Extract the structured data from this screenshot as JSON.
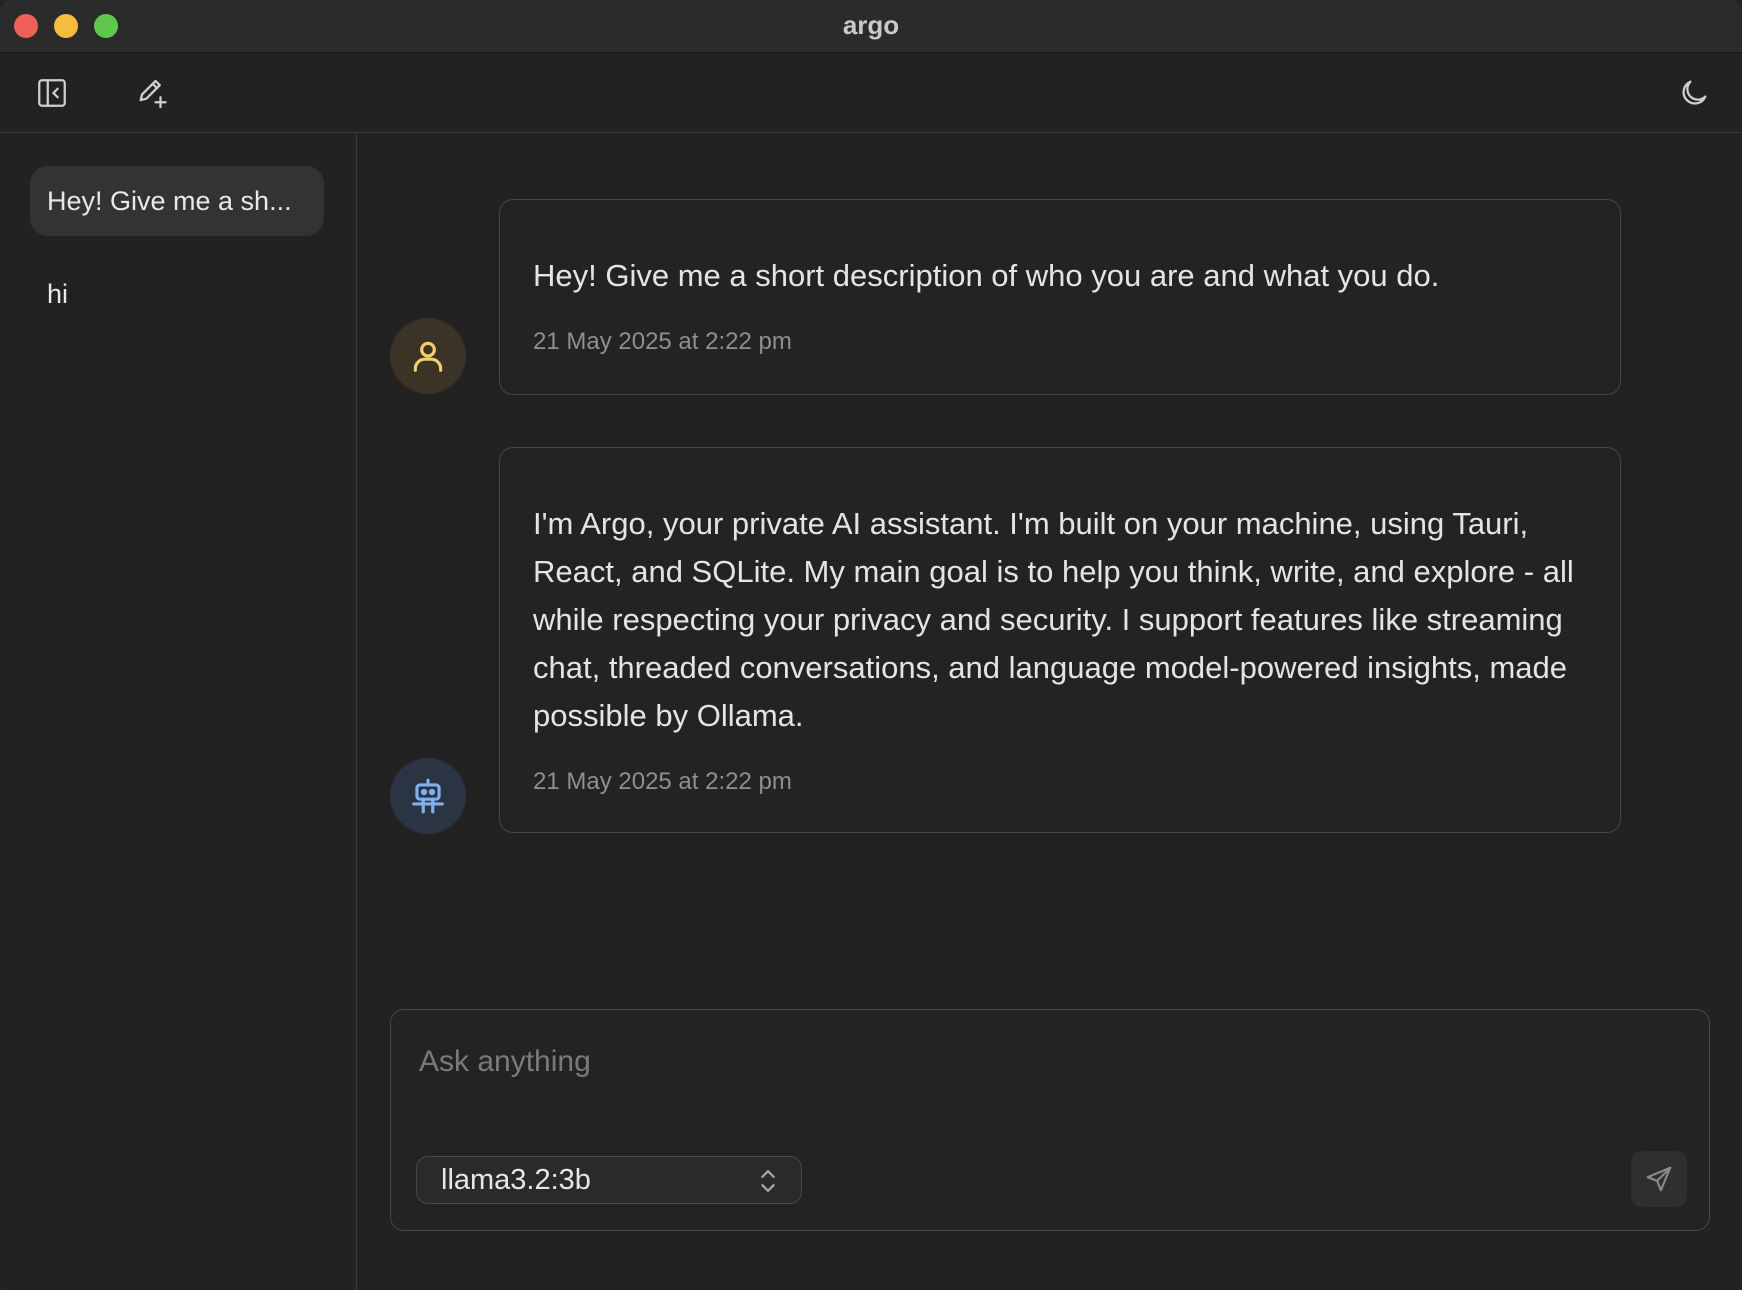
{
  "window": {
    "title": "argo"
  },
  "toolbar": {
    "toggle_sidebar_icon": "sidebar-toggle-icon",
    "new_chat_icon": "new-chat-pencil-icon",
    "theme_icon": "moon-icon"
  },
  "sidebar": {
    "conversations": [
      {
        "label": "Hey! Give me a sh...",
        "active": true
      },
      {
        "label": "hi",
        "active": false
      }
    ]
  },
  "messages": [
    {
      "role": "user",
      "avatar_icon": "user-icon",
      "text": "Hey! Give me a short description of who you are and what you do.",
      "time": "21 May 2025 at 2:22 pm"
    },
    {
      "role": "assistant",
      "avatar_icon": "robot-icon",
      "text": "I'm Argo, your private AI assistant. I'm built on your machine, using Tauri, React, and SQLite. My main goal is to help you think, write, and explore - all while respecting your privacy and security. I support features like streaming chat, threaded conversations, and language model-powered insights, made possible by Ollama.",
      "time": "21 May 2025 at 2:22 pm"
    }
  ],
  "composer": {
    "placeholder": "Ask anything",
    "value": "",
    "model": "llama3.2:3b",
    "send_icon": "send-icon"
  },
  "colors": {
    "background": "#222222",
    "titlebar": "#2b2b2b",
    "user_avatar_bg": "#3b3326",
    "user_avatar_fg": "#f2cf6b",
    "bot_avatar_bg": "#2a3443",
    "bot_avatar_fg": "#7fb1ee",
    "close": "#ee5f57",
    "minimize": "#f4bd3f",
    "maximize": "#5fc84c"
  }
}
